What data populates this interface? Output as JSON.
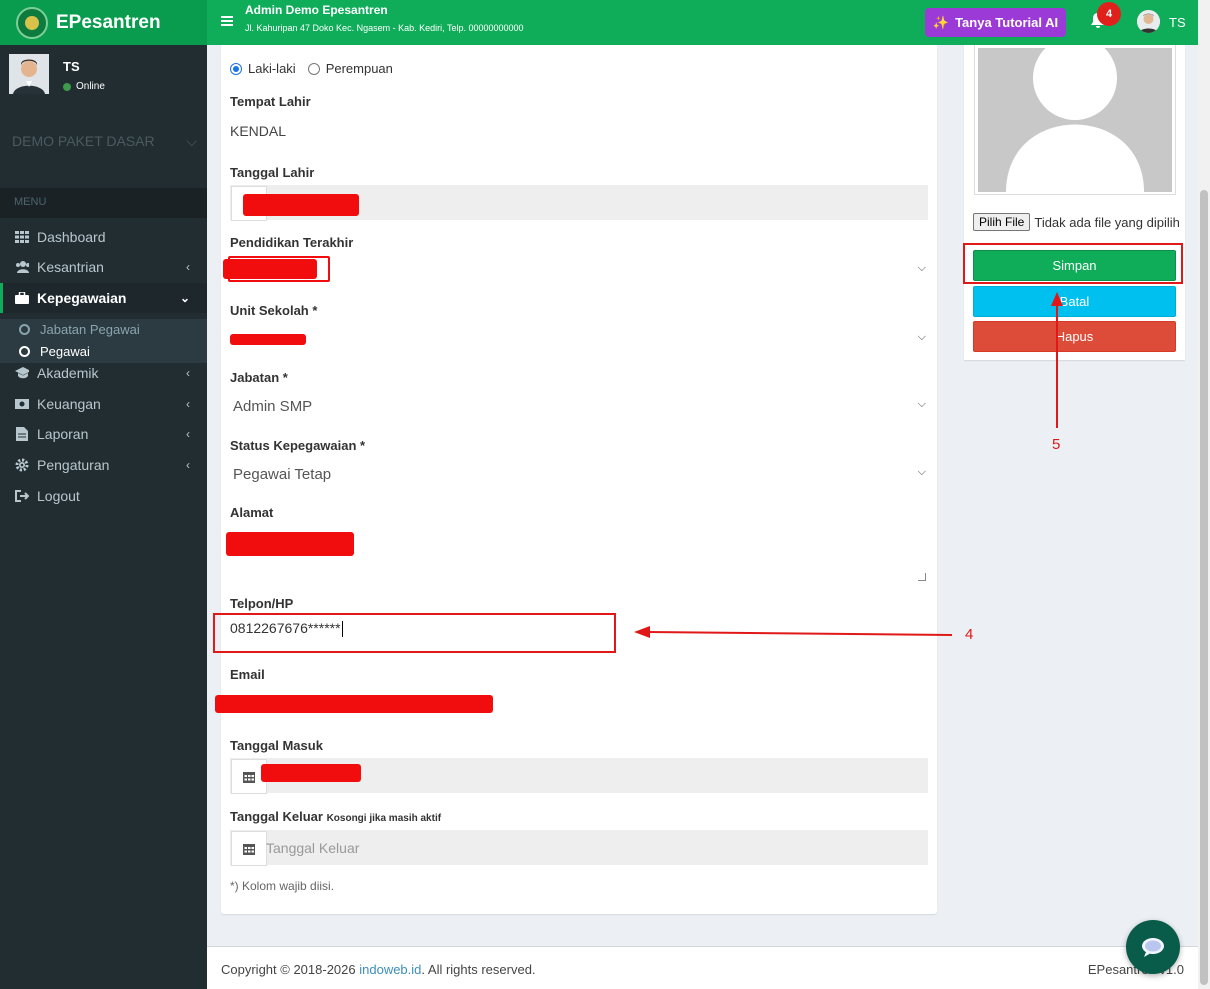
{
  "brand": {
    "name": "EPesantren"
  },
  "navbar": {
    "title": "Admin Demo Epesantren",
    "address": "Jl. Kahuripan 47 Doko Kec. Ngasem - Kab. Kediri, Telp. 00000000000",
    "ai_button": "Tanya Tutorial AI",
    "notification_count": "4",
    "user": "TS"
  },
  "sidebar": {
    "user_name": "TS",
    "user_status": "Online",
    "package": "DEMO PAKET DASAR",
    "menu_header": "MENU",
    "items": [
      {
        "label": "Dashboard"
      },
      {
        "label": "Kesantrian"
      },
      {
        "label": "Kepegawaian"
      },
      {
        "label": "Akademik"
      },
      {
        "label": "Keuangan"
      },
      {
        "label": "Laporan"
      },
      {
        "label": "Pengaturan"
      },
      {
        "label": "Logout"
      }
    ],
    "subitems": [
      {
        "label": "Jabatan Pegawai"
      },
      {
        "label": "Pegawai"
      }
    ]
  },
  "form": {
    "gender_options": [
      "Laki-laki",
      "Perempuan"
    ],
    "gender_selected": "Laki-laki",
    "birth_place_label": "Tempat Lahir",
    "birth_place_value": "KENDAL",
    "birth_date_label": "Tanggal Lahir",
    "education_label": "Pendidikan Terakhir",
    "unit_label": "Unit Sekolah *",
    "position_label": "Jabatan *",
    "position_value": "Admin SMP",
    "status_label": "Status Kepegawaian *",
    "status_value": "Pegawai Tetap",
    "address_label": "Alamat",
    "phone_label": "Telpon/HP",
    "phone_value": "0812267676******",
    "email_label": "Email",
    "start_date_label": "Tanggal Masuk",
    "end_date_label": "Tanggal Keluar",
    "end_date_hint": "Kosongi jika masih aktif",
    "end_date_placeholder": "Tanggal Keluar",
    "required_note": "*) Kolom wajib diisi."
  },
  "photo_panel": {
    "file_button": "Pilih File",
    "file_status": "Tidak ada file yang dipilih",
    "save": "Simpan",
    "cancel": "Batal",
    "delete": "Hapus"
  },
  "annotations": {
    "four": "4",
    "five": "5"
  },
  "footer": {
    "copyright_prefix": "Copyright © 2018-2026 ",
    "copyright_link": "indoweb.id",
    "copyright_suffix": ". All rights reserved.",
    "version": "EPesantren v1.0"
  },
  "colors": {
    "primary": "#0fad59",
    "sidebar": "#222d32",
    "annotation": "#e01818",
    "ai": "#9b3ad6"
  }
}
